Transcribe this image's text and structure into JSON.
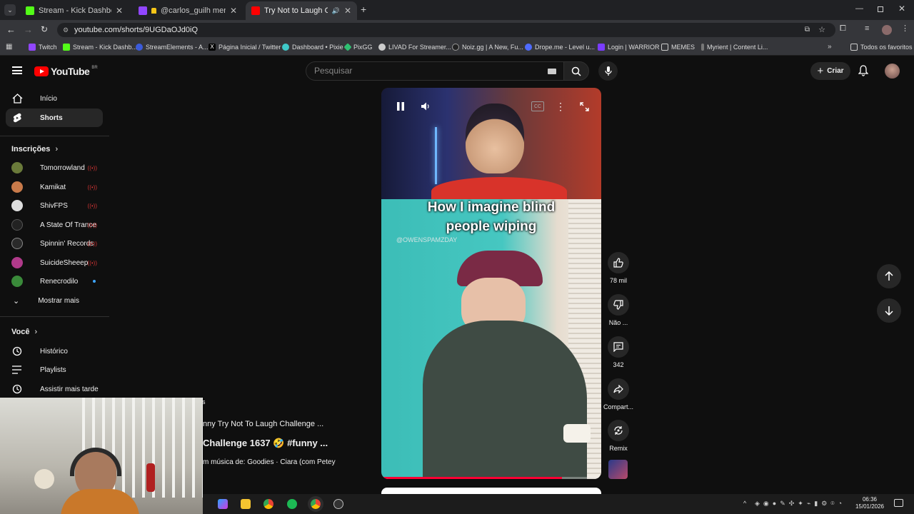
{
  "browser": {
    "tabs": [
      {
        "title": "Stream - Kick Dashboard",
        "color": "#53fc18"
      },
      {
        "title": "@carlos_guilh mentioned y...",
        "color": "#9146ff"
      },
      {
        "title": "Try Not to Laugh Challenge",
        "color": "#ff0000"
      }
    ],
    "url": "youtube.com/shorts/9UGDaOJd0iQ",
    "bookmarks": [
      {
        "label": "Twitch",
        "color": "#9146ff"
      },
      {
        "label": "Stream - Kick Dashb...",
        "color": "#53fc18"
      },
      {
        "label": "StreamElements - A...",
        "color": "#3b5bdb"
      },
      {
        "label": "Página Inicial / Twitter",
        "color": "#ffffff"
      },
      {
        "label": "Dashboard • Pixie",
        "color": "#3fc9c9"
      },
      {
        "label": "PixGG",
        "color": "#2fbf71"
      },
      {
        "label": "LIVAD For Streamer...",
        "color": "#cccccc"
      },
      {
        "label": "Noiz.gg | A New, Fu...",
        "color": "#222222"
      },
      {
        "label": "Drope.me - Level u...",
        "color": "#4f6bff"
      },
      {
        "label": "Login | WARRIOR",
        "color": "#7a3cff"
      },
      {
        "label": "MEMES",
        "color": "#888888"
      },
      {
        "label": "Myrient | Content Li...",
        "color": "#777777"
      }
    ],
    "all_favorites": "Todos os favoritos"
  },
  "youtube": {
    "logo_text": "YouTube",
    "logo_region": "BR",
    "search_placeholder": "Pesquisar",
    "create_label": "Criar"
  },
  "sidebar": {
    "home": "Início",
    "shorts": "Shorts",
    "subscriptions_title": "Inscrições",
    "subscriptions": [
      {
        "name": "Tomorrowland",
        "live": true,
        "color": "#6a7a3a"
      },
      {
        "name": "Kamikat",
        "live": true,
        "color": "#c87a4a"
      },
      {
        "name": "ShivFPS",
        "live": true,
        "color": "#dddddd"
      },
      {
        "name": "A State Of Trance",
        "live": true,
        "color": "#222222"
      },
      {
        "name": "Spinnin' Records",
        "live": true,
        "color": "#2a2a2a"
      },
      {
        "name": "SuicideSheeep",
        "live": true,
        "color": "#b03a8a"
      },
      {
        "name": "Renecrodilo",
        "live": false,
        "new": true,
        "color": "#3a8a3a"
      }
    ],
    "show_more": "Mostrar mais",
    "you_title": "Você",
    "history": "Histórico",
    "playlists": "Playlists",
    "watch_later": "Assistir mais tarde"
  },
  "video": {
    "caption_line1": "How I imagine blind",
    "caption_line2": "people wiping",
    "watermark": "@OWENSPAMZDAY",
    "progress": 0.82
  },
  "actions": {
    "likes": "78 mil",
    "dislike": "Não ...",
    "comments": "342",
    "share": "Compart...",
    "remix": "Remix"
  },
  "overlay": {
    "line1": "nny Try Not To Laugh Challenge ...",
    "line2": "Challenge 1637 🤣 #funny ...",
    "line3": "m música de: Goodies · Ciara (com Petey",
    "stray": "s"
  },
  "taskbar": {
    "time": "06:36",
    "date": "15/01/2026"
  }
}
